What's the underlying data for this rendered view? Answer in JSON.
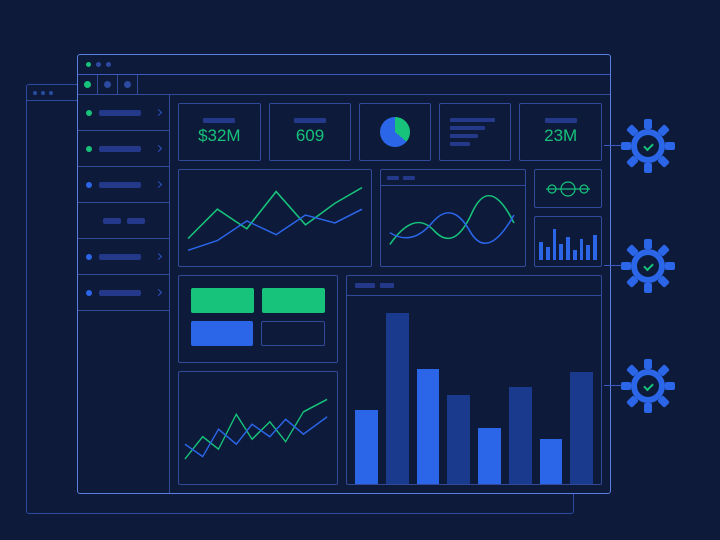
{
  "colors": {
    "accent": "#17c27a",
    "primary": "#2b66e8",
    "line": "#314a9a",
    "bg": "#0d1a3a"
  },
  "sidebar": {
    "items": [
      {
        "bullet": "g"
      },
      {
        "bullet": "g"
      },
      {
        "bullet": "b"
      },
      {
        "group": true
      },
      {
        "bullet": "b"
      },
      {
        "bullet": "b"
      }
    ]
  },
  "metrics": {
    "a": {
      "value": "$32M"
    },
    "b": {
      "value": "609"
    },
    "c": {
      "value": "23M"
    }
  },
  "chart_data": [
    {
      "type": "line",
      "title": "",
      "x": [
        0,
        1,
        2,
        3,
        4,
        5,
        6
      ],
      "series": [
        {
          "name": "green",
          "values": [
            30,
            55,
            35,
            72,
            40,
            62,
            78
          ],
          "color": "#17c27a"
        },
        {
          "name": "blue",
          "values": [
            18,
            28,
            46,
            30,
            50,
            42,
            55
          ],
          "color": "#2b66e8"
        }
      ],
      "ylim": [
        0,
        100
      ]
    },
    {
      "type": "line",
      "title": "",
      "x": [
        0,
        1,
        2,
        3,
        4,
        5,
        6
      ],
      "series": [
        {
          "name": "green",
          "values": [
            22,
            48,
            30,
            58,
            40,
            62,
            50
          ],
          "color": "#17c27a"
        },
        {
          "name": "blue",
          "values": [
            35,
            28,
            50,
            36,
            55,
            42,
            58
          ],
          "color": "#2b66e8"
        }
      ],
      "ylim": [
        0,
        100
      ]
    },
    {
      "type": "pie",
      "slices": [
        {
          "name": "a",
          "value": 36,
          "color": "#17c27a"
        },
        {
          "name": "b",
          "value": 64,
          "color": "#2b66e8"
        }
      ]
    },
    {
      "type": "bar",
      "categories": [
        "1",
        "2",
        "3",
        "4",
        "5",
        "6",
        "7",
        "8",
        "9"
      ],
      "values": [
        18,
        12,
        30,
        15,
        22,
        10,
        20,
        14,
        24
      ],
      "ylim": [
        0,
        35
      ],
      "color": "#2b66e8"
    },
    {
      "type": "bar",
      "categories": [
        "1",
        "2",
        "3",
        "4",
        "5",
        "6",
        "7",
        "8"
      ],
      "series": [
        {
          "name": "light",
          "values": [
            40,
            92,
            62,
            48,
            30,
            52,
            24,
            60
          ],
          "color": "#2b66e8"
        },
        {
          "name": "dark",
          "values": [
            40,
            92,
            62,
            48,
            30,
            52,
            24,
            60
          ],
          "color": "#1a3a8e"
        }
      ],
      "interleave": true,
      "ylim": [
        0,
        100
      ]
    },
    {
      "type": "line",
      "x": [
        0,
        1,
        2,
        3,
        4,
        5,
        6,
        7,
        8
      ],
      "series": [
        {
          "name": "green",
          "values": [
            20,
            35,
            25,
            48,
            30,
            45,
            32,
            52,
            60
          ],
          "color": "#17c27a"
        },
        {
          "name": "blue",
          "values": [
            30,
            22,
            40,
            28,
            44,
            34,
            48,
            38,
            50
          ],
          "color": "#2b66e8"
        }
      ],
      "ylim": [
        0,
        70
      ]
    }
  ],
  "gears": [
    {
      "status": "ok"
    },
    {
      "status": "ok"
    },
    {
      "status": "ok"
    }
  ]
}
